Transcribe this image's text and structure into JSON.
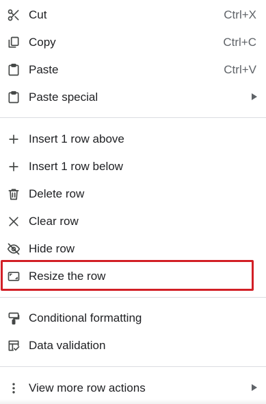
{
  "menu": {
    "cut": {
      "label": "Cut",
      "shortcut": "Ctrl+X",
      "icon": "scissors-icon"
    },
    "copy": {
      "label": "Copy",
      "shortcut": "Ctrl+C",
      "icon": "copy-icon"
    },
    "paste": {
      "label": "Paste",
      "shortcut": "Ctrl+V",
      "icon": "clipboard-icon"
    },
    "paste_special": {
      "label": "Paste special",
      "icon": "clipboard-icon",
      "has_submenu": true
    },
    "insert_above": {
      "label": "Insert 1 row above",
      "icon": "plus-icon"
    },
    "insert_below": {
      "label": "Insert 1 row below",
      "icon": "plus-icon"
    },
    "delete_row": {
      "label": "Delete row",
      "icon": "trash-icon"
    },
    "clear_row": {
      "label": "Clear row",
      "icon": "close-icon"
    },
    "hide_row": {
      "label": "Hide row",
      "icon": "eye-off-icon"
    },
    "resize_row": {
      "label": "Resize the row",
      "icon": "resize-icon",
      "highlighted": true
    },
    "conditional_formatting": {
      "label": "Conditional formatting",
      "icon": "paint-roller-icon"
    },
    "data_validation": {
      "label": "Data validation",
      "icon": "data-validation-icon"
    },
    "more_row_actions": {
      "label": "View more row actions",
      "icon": "more-vertical-icon",
      "has_submenu": true
    }
  },
  "colors": {
    "text": "#202124",
    "secondary_text": "#5f6368",
    "icon": "#444746",
    "divider": "#dadce0",
    "highlight_border": "#d21f26"
  }
}
